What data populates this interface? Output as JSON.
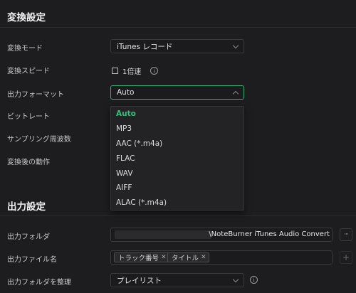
{
  "conversion": {
    "title": "変換設定",
    "mode": {
      "label": "変換モード",
      "value": "iTunes レコード"
    },
    "speed": {
      "label": "変換スピード",
      "checkbox_label": "1倍速"
    },
    "format": {
      "label": "出力フォーマット",
      "value": "Auto",
      "options": [
        "Auto",
        "MP3",
        "AAC (*.m4a)",
        "FLAC",
        "WAV",
        "AIFF",
        "ALAC (*.m4a)"
      ]
    },
    "bitrate": {
      "label": "ビットレート"
    },
    "samplerate": {
      "label": "サンプリング周波数"
    },
    "after": {
      "label": "変換後の動作"
    }
  },
  "output": {
    "title": "出力設定",
    "folder": {
      "label": "出力フォルダ",
      "path": "\\NoteBurner iTunes Audio Convert",
      "browse": "···"
    },
    "filename": {
      "label": "出力ファイル名",
      "tags": [
        "トラック番号",
        "タイトル"
      ],
      "add": "+"
    },
    "organize": {
      "label": "出力フォルダを整理",
      "value": "プレイリスト"
    }
  },
  "colors": {
    "accent": "#36b277",
    "selected_option": "#39c07f",
    "background": "#1d1d1f"
  },
  "icons": {
    "info": "info-icon",
    "chevron": "chevron-down-icon",
    "remove": "close-icon"
  }
}
